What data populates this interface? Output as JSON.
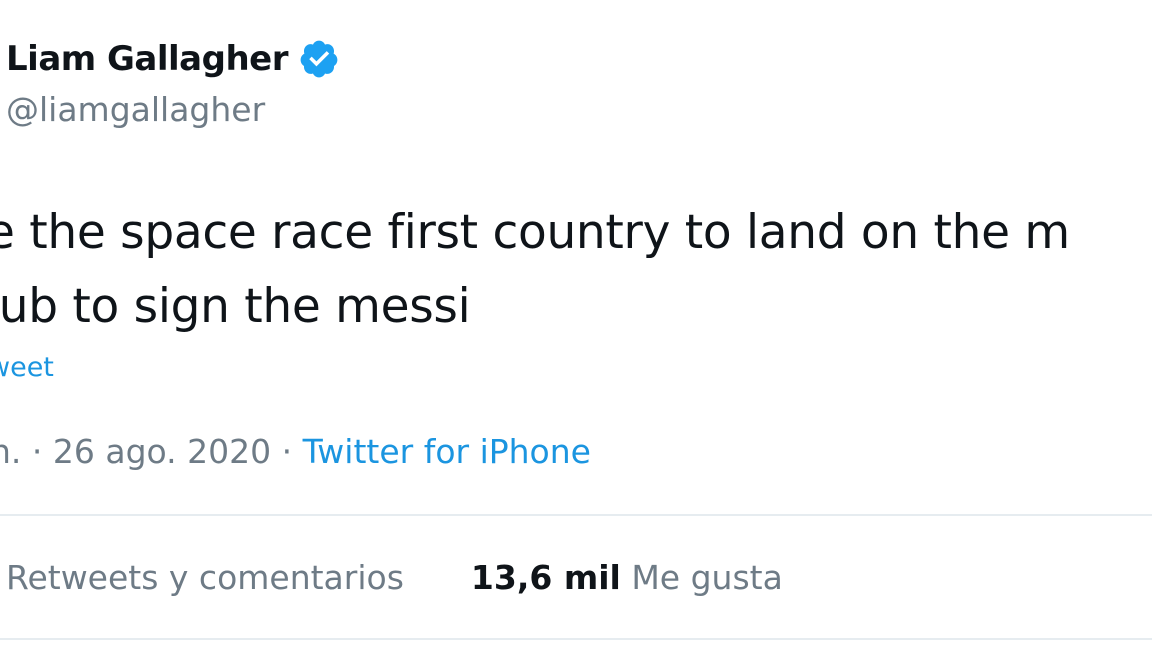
{
  "author": {
    "name": "Liam Gallagher",
    "handle": "@liamgallagher",
    "verified_icon": "verified-badge-icon",
    "verified_color": "#1da1f2"
  },
  "tweet": {
    "lines": [
      "e the space race first country to land on the m",
      "lub to sign the messi"
    ],
    "translate_label": "weet"
  },
  "meta": {
    "time_fragment": "n.",
    "separator": "·",
    "date": "26 ago. 2020",
    "source": "Twitter for iPhone"
  },
  "stats": {
    "retweets_label": "Retweets y comentarios",
    "likes_count": "13,6 mil",
    "likes_label": "Me gusta"
  },
  "colors": {
    "link": "#1b95e0",
    "secondary_text": "#6e7b86",
    "divider": "#e6ecf0"
  }
}
